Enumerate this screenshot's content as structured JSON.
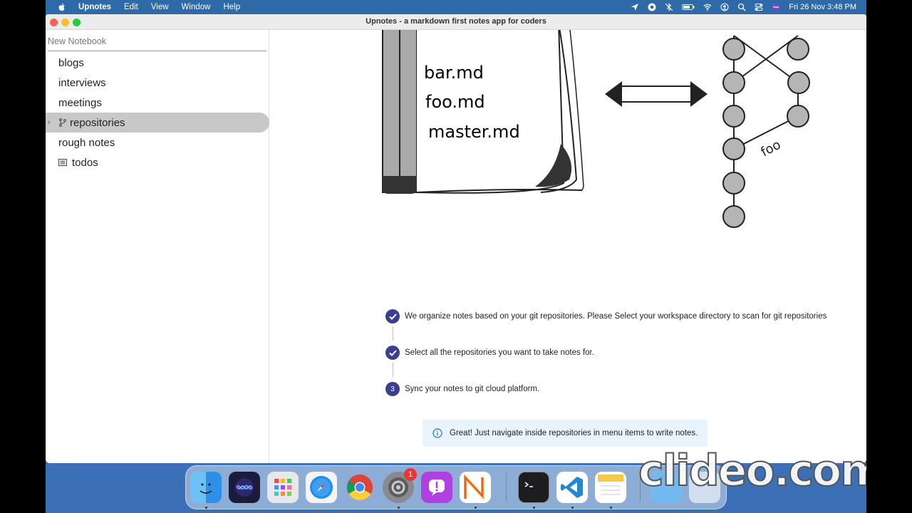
{
  "menubar": {
    "app_name": "Upnotes",
    "menus": [
      "Edit",
      "View",
      "Window",
      "Help"
    ],
    "clock": "Fri 26 Nov  3:48 PM"
  },
  "window": {
    "title": "Upnotes - a markdown first notes app for coders"
  },
  "sidebar": {
    "new_notebook_placeholder": "New Notebook",
    "items": [
      {
        "label": "blogs"
      },
      {
        "label": "interviews"
      },
      {
        "label": "meetings"
      },
      {
        "label": "repositories"
      },
      {
        "label": "rough notes"
      },
      {
        "label": "todos"
      }
    ]
  },
  "illustration": {
    "files": [
      "bar.md",
      "foo.md",
      "master.md"
    ],
    "branch_label": "foo"
  },
  "steps": [
    {
      "marker": "",
      "text": "We organize notes based on your git repositories. Please Select your workspace directory to scan for git repositories",
      "done": true
    },
    {
      "marker": "",
      "text": "Select all the repositories you want to take notes for.",
      "done": true
    },
    {
      "marker": "3",
      "text": "Sync your notes to git cloud platform.",
      "done": false
    }
  ],
  "info_banner": {
    "text": "Great! Just navigate inside repositories in menu items to write notes."
  },
  "dock": {
    "notification_badge": "1",
    "icons": [
      "finder-icon",
      "siri-icon",
      "launchpad-icon",
      "safari-icon",
      "chrome-icon",
      "system-preferences-icon",
      "feedback-icon",
      "notes-app-icon",
      "terminal-icon",
      "vscode-icon",
      "notes-icon",
      "folder-icon",
      "trash-icon"
    ]
  },
  "watermark": "clideo.com",
  "colors": {
    "accent": "#3a3f8f",
    "selected_row": "#c8c8c8",
    "info_bg": "#e9f3fb",
    "desktop": "#3b6fb6"
  }
}
